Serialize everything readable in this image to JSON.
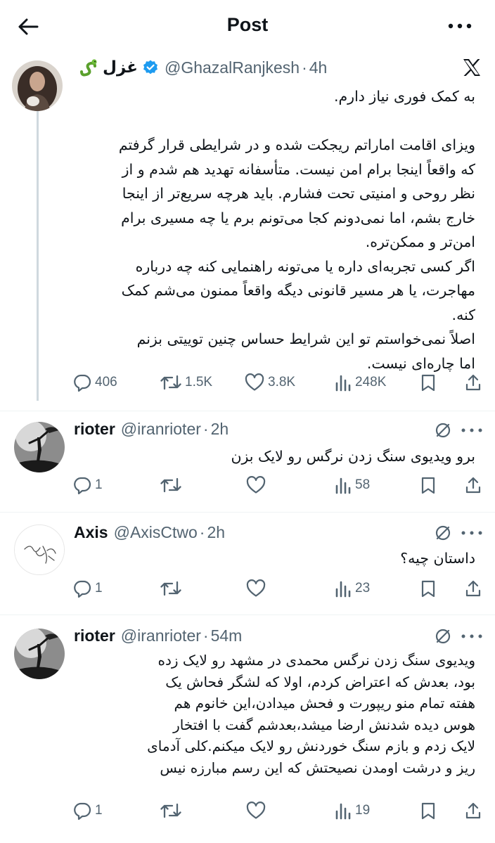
{
  "header": {
    "title": "Post"
  },
  "main_post": {
    "display_name": "غزل",
    "handle": "@GhazalRanjkesh",
    "separator": "·",
    "time": "4h",
    "lines": [
      "به کمک فوری نیاز دارم.",
      "",
      "ویزای اقامت اماراتم ریجکت شده و در شرایطی قرار گرفتم",
      "که واقعاً اینجا برام امن نیست. متأسفانه تهدید هم شدم و از",
      "نظر روحی و امنیتی تحت فشارم. باید هرچه سریع‌تر از اینجا",
      "خارج بشم، اما نمی‌دونم کجا می‌تونم برم یا چه مسیری برام",
      "امن‌تر و ممکن‌تره.",
      "اگر کسی تجربه‌ای داره یا می‌تونه راهنمایی کنه چه درباره",
      "مهاجرت، یا هر مسیر قانونی دیگه واقعاً ممنون می‌شم کمک",
      "کنه.",
      "اصلاً نمی‌خواستم تو این شرایط حساس چنین توییتی بزنم",
      "اما چاره‌ای نیست."
    ],
    "stats": {
      "replies": "406",
      "reposts": "1.5K",
      "likes": "3.8K",
      "views": "248K"
    }
  },
  "replies": [
    {
      "display_name": "rioter",
      "handle": "@iranrioter",
      "separator": "·",
      "time": "2h",
      "lines": [
        "برو ویدیوی سنگ زدن نرگس رو لایک بزن"
      ],
      "stats": {
        "replies": "1",
        "reposts": "",
        "likes": "",
        "views": "58"
      }
    },
    {
      "display_name": "Axis",
      "handle": "@AxisCtwo",
      "separator": "·",
      "time": "2h",
      "lines": [
        "داستان چیه؟"
      ],
      "stats": {
        "replies": "1",
        "reposts": "",
        "likes": "",
        "views": "23"
      }
    },
    {
      "display_name": "rioter",
      "handle": "@iranrioter",
      "separator": "·",
      "time": "54m",
      "lines": [
        "ویدیوی سنگ زدن نرگس محمدی در مشهد رو لایک زده",
        "بود، بعدش که اعتراض کردم، اولا که لشگر فحاش یک",
        "هفته تمام منو ریپورت و فحش میدادن،این خانوم هم",
        "هوس دیده شدنش ارضا میشد،بعدشم گفت با افتخار",
        "لایک زدم و بازم سنگ خوردنش رو لایک میکنم.کلی آدمای",
        "ریز و درشت اومدن نصیحتش که این رسم مبارزه نیس"
      ],
      "stats": {
        "replies": "1",
        "reposts": "",
        "likes": "",
        "views": "19"
      }
    }
  ],
  "colors": {
    "text": "#0f1419",
    "secondary": "#536471",
    "verified": "#1d9bf0",
    "divider": "#eff3f4",
    "thread_line": "#cfd9de"
  },
  "icons": [
    "back-arrow-icon",
    "more-icon",
    "x-logo-icon",
    "verified-badge-icon",
    "snake-emoji-icon",
    "reply-icon",
    "repost-icon",
    "like-icon",
    "views-icon",
    "bookmark-icon",
    "share-icon",
    "grok-icon"
  ]
}
